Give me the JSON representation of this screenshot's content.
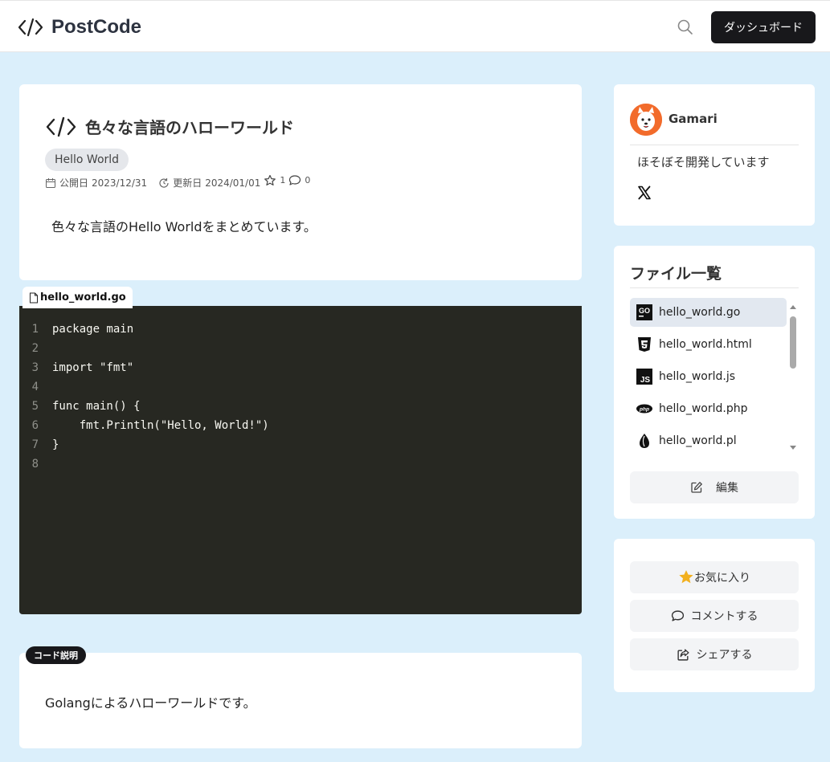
{
  "header": {
    "logo_text": "PostCode",
    "dashboard_label": "ダッシュボード"
  },
  "post": {
    "title": "色々な言語のハローワールド",
    "tag": "Hello World",
    "published_label": "公開日",
    "published_date": "2023/12/31",
    "updated_label": "更新日",
    "updated_date": "2024/01/01",
    "star_count": "1",
    "comment_count": "0",
    "summary": "色々な言語のHello Worldをまとめています。"
  },
  "code_block": {
    "filename": "hello_world.go",
    "lines": [
      {
        "n": "1",
        "text": "package main"
      },
      {
        "n": "2",
        "text": ""
      },
      {
        "n": "3",
        "text": "import \"fmt\""
      },
      {
        "n": "4",
        "text": ""
      },
      {
        "n": "5",
        "text": "func main() {"
      },
      {
        "n": "6",
        "text": "    fmt.Println(\"Hello, World!\")"
      },
      {
        "n": "7",
        "text": "}"
      },
      {
        "n": "8",
        "text": ""
      }
    ]
  },
  "explanation": {
    "label": "コード説明",
    "text": "Golangによるハローワールドです。"
  },
  "author": {
    "name": "Gamari",
    "bio": "ほそぼそ開発しています"
  },
  "files": {
    "title": "ファイル一覧",
    "items": [
      {
        "name": "hello_world.go",
        "icon": "go-icon",
        "active": true
      },
      {
        "name": "hello_world.html",
        "icon": "html5-icon",
        "active": false
      },
      {
        "name": "hello_world.js",
        "icon": "js-icon",
        "active": false
      },
      {
        "name": "hello_world.php",
        "icon": "php-icon",
        "active": false
      },
      {
        "name": "hello_world.pl",
        "icon": "perl-icon",
        "active": false
      }
    ],
    "edit_label": "編集"
  },
  "actions": {
    "favorite_label": "お気に入り",
    "comment_label": "コメントする",
    "share_label": "シェアする"
  },
  "colors": {
    "page_bg": "#dbeffb",
    "code_bg": "#272822",
    "primary_btn": "#18181b",
    "star": "#f2b01e"
  }
}
